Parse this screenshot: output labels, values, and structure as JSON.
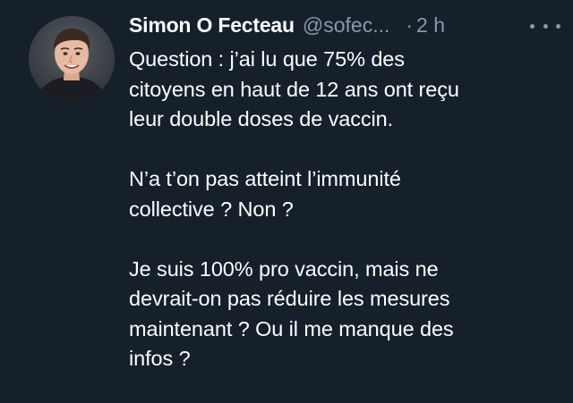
{
  "author": {
    "display_name": "Simon O Fecteau",
    "handle": "@sofec...",
    "separator": "·",
    "time": "2 h",
    "avatar_icon": "profile-photo"
  },
  "more_icon": "more-options-icon",
  "tweet": {
    "paragraphs": [
      [
        "Question : j’ai lu que 75% des",
        "citoyens en haut de 12 ans ont reçu",
        "leur double doses de vaccin."
      ],
      [
        "N’a t’on pas atteint l’immunité",
        "collective ? Non ?"
      ],
      [
        "Je suis 100% pro vaccin, mais ne",
        "devrait-on pas réduire les mesures",
        "maintenant ? Ou il me manque des",
        "infos ?"
      ]
    ]
  },
  "colors": {
    "background": "#15202b",
    "text_primary": "#ffffff",
    "text_secondary": "#8b98a5"
  }
}
